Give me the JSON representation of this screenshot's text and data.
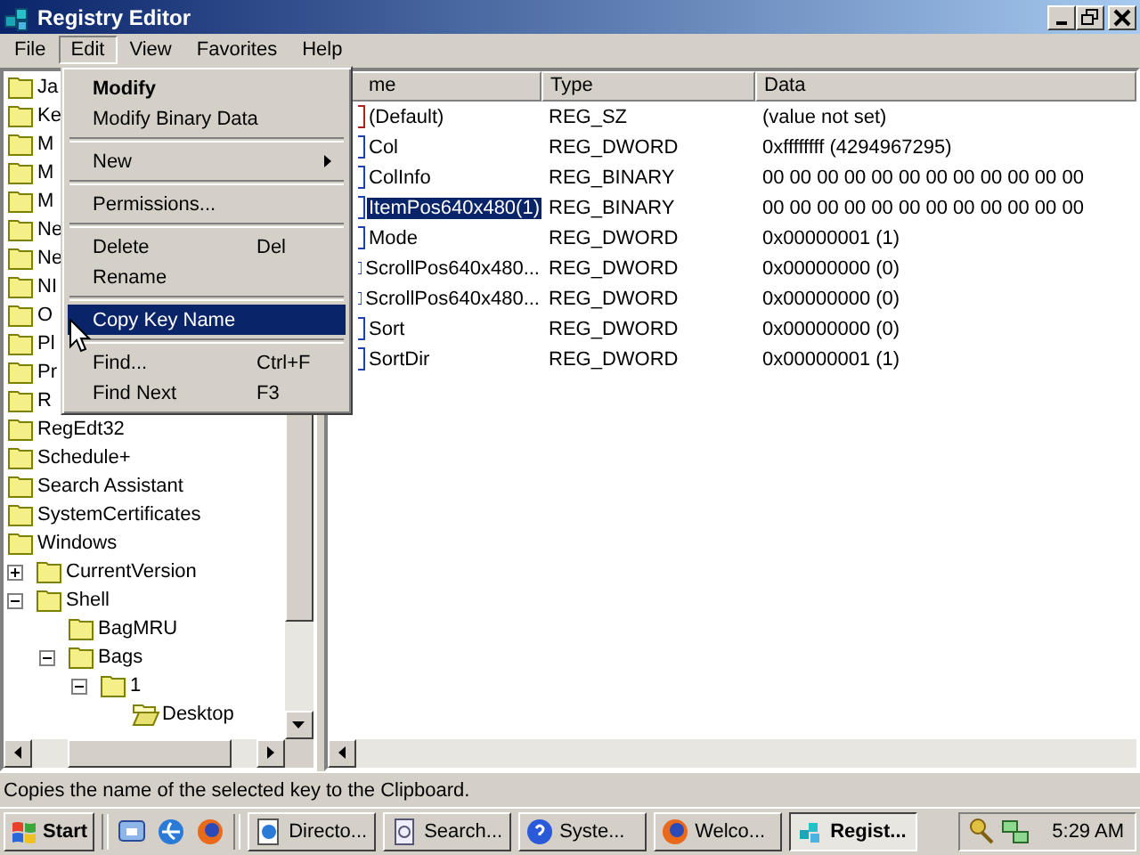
{
  "window": {
    "title": "Registry Editor"
  },
  "menubar": [
    {
      "label": "File",
      "selected": false
    },
    {
      "label": "Edit",
      "selected": true
    },
    {
      "label": "View",
      "selected": false
    },
    {
      "label": "Favorites",
      "selected": false
    },
    {
      "label": "Help",
      "selected": false
    }
  ],
  "edit_menu": [
    {
      "kind": "item",
      "label": "Modify",
      "default": true,
      "submenu": false,
      "selected": false
    },
    {
      "kind": "item",
      "label": "Modify Binary Data",
      "default": false,
      "submenu": false,
      "selected": false
    },
    {
      "kind": "separator"
    },
    {
      "kind": "item",
      "label": "New",
      "default": false,
      "submenu": true,
      "selected": false
    },
    {
      "kind": "separator"
    },
    {
      "kind": "item",
      "label": "Permissions...",
      "default": false,
      "submenu": false,
      "selected": false
    },
    {
      "kind": "separator"
    },
    {
      "kind": "item",
      "label": "Delete",
      "shortcut": "Del",
      "default": false,
      "submenu": false,
      "selected": false
    },
    {
      "kind": "item",
      "label": "Rename",
      "default": false,
      "submenu": false,
      "selected": false
    },
    {
      "kind": "separator"
    },
    {
      "kind": "item",
      "label": "Copy Key Name",
      "default": false,
      "submenu": false,
      "selected": true
    },
    {
      "kind": "separator"
    },
    {
      "kind": "item",
      "label": "Find...",
      "shortcut": "Ctrl+F",
      "default": false,
      "submenu": false,
      "selected": false
    },
    {
      "kind": "item",
      "label": "Find Next",
      "shortcut": "F3",
      "default": false,
      "submenu": false,
      "selected": false
    }
  ],
  "tree": [
    {
      "label": "Ja",
      "selected": false
    },
    {
      "label": "Ke",
      "selected": false
    },
    {
      "label": "M",
      "selected": false
    },
    {
      "label": "M",
      "selected": false
    },
    {
      "label": "M",
      "selected": false
    },
    {
      "label": "Ne",
      "selected": false
    },
    {
      "label": "Ne",
      "selected": false
    },
    {
      "label": "NI",
      "selected": false
    },
    {
      "label": "O",
      "selected": false
    },
    {
      "label": "Pl",
      "selected": false
    },
    {
      "label": "Pr",
      "selected": false
    },
    {
      "label": "R",
      "selected": false
    },
    {
      "label": "RegEdt32",
      "selected": false
    },
    {
      "label": "Schedule+",
      "selected": false
    },
    {
      "label": "Search Assistant",
      "selected": false
    },
    {
      "label": "SystemCertificates",
      "selected": false
    },
    {
      "label": "Windows",
      "selected": false,
      "children": [
        {
          "label": "CurrentVersion",
          "selected": false,
          "expanded": false
        },
        {
          "label": "Shell",
          "selected": false,
          "expanded": true,
          "children": [
            {
              "label": "BagMRU",
              "selected": false
            },
            {
              "label": "Bags",
              "selected": false,
              "expanded": true,
              "children": [
                {
                  "label": "1",
                  "selected": false,
                  "expanded": true,
                  "children": [
                    {
                      "label": "Desktop",
                      "selected": true
                    }
                  ]
                }
              ]
            }
          ]
        }
      ]
    }
  ],
  "list": {
    "columns": [
      "me",
      "Type",
      "Data"
    ],
    "rows": [
      {
        "kind": "string",
        "name": "(Default)",
        "type": "REG_SZ",
        "data": "(value not set)",
        "selected": false
      },
      {
        "kind": "binary",
        "name": "Col",
        "type": "REG_DWORD",
        "data": "0xffffffff (4294967295)",
        "selected": false
      },
      {
        "kind": "binary",
        "name": "ColInfo",
        "type": "REG_BINARY",
        "data": "00 00 00 00 00 00 00 00 00 00 00 00",
        "selected": false
      },
      {
        "kind": "binary",
        "name": "ItemPos640x480(1)",
        "type": "REG_BINARY",
        "data": "00 00 00 00 00 00 00 00 00 00 00 00",
        "selected": true
      },
      {
        "kind": "binary",
        "name": "Mode",
        "type": "REG_DWORD",
        "data": "0x00000001 (1)",
        "selected": false
      },
      {
        "kind": "binary",
        "name": "ScrollPos640x480...",
        "type": "REG_DWORD",
        "data": "0x00000000 (0)",
        "selected": false
      },
      {
        "kind": "binary",
        "name": "ScrollPos640x480...",
        "type": "REG_DWORD",
        "data": "0x00000000 (0)",
        "selected": false
      },
      {
        "kind": "binary",
        "name": "Sort",
        "type": "REG_DWORD",
        "data": "0x00000000 (0)",
        "selected": false
      },
      {
        "kind": "binary",
        "name": "SortDir",
        "type": "REG_DWORD",
        "data": "0x00000001 (1)",
        "selected": false
      }
    ]
  },
  "status_bar": "Copies the name of the selected key to the Clipboard.",
  "taskbar": {
    "start": "Start",
    "tasks": [
      {
        "label": "Directo...",
        "selected": false
      },
      {
        "label": "Search...",
        "selected": false
      },
      {
        "label": "Syste...",
        "selected": false
      },
      {
        "label": "Welco...",
        "selected": false
      },
      {
        "label": "Regist...",
        "selected": true
      }
    ],
    "clock": "5:29 AM"
  }
}
